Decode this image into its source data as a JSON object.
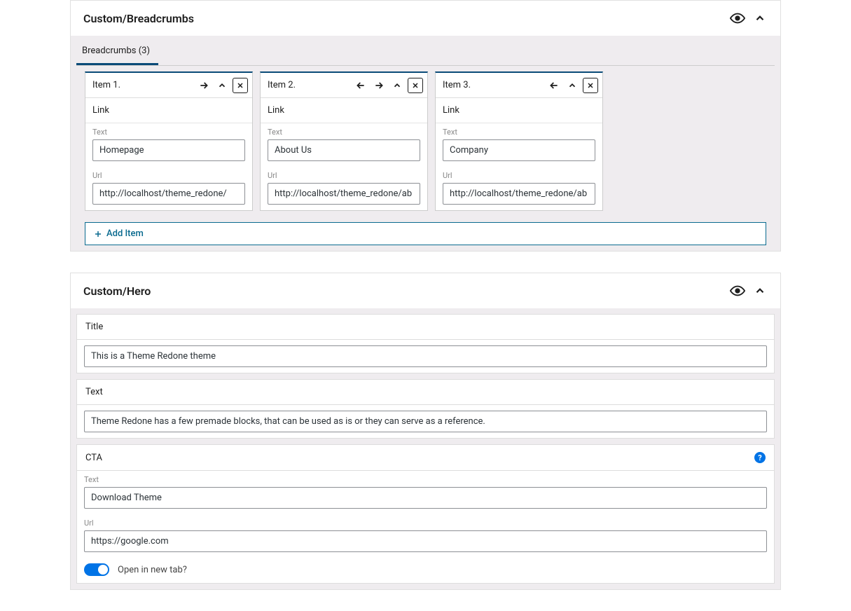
{
  "blocks": {
    "breadcrumbs": {
      "title": "Custom/Breadcrumbs",
      "tab_label": "Breadcrumbs (3)",
      "add_item_label": "Add Item",
      "items": [
        {
          "title": "Item 1.",
          "show_prev": false,
          "show_next": true,
          "link_label": "Link",
          "text_label": "Text",
          "text_value": "Homepage",
          "url_label": "Url",
          "url_value": "http://localhost/theme_redone/"
        },
        {
          "title": "Item 2.",
          "show_prev": true,
          "show_next": true,
          "link_label": "Link",
          "text_label": "Text",
          "text_value": "About Us",
          "url_label": "Url",
          "url_value": "http://localhost/theme_redone/ab"
        },
        {
          "title": "Item 3.",
          "show_prev": true,
          "show_next": false,
          "link_label": "Link",
          "text_label": "Text",
          "text_value": "Company",
          "url_label": "Url",
          "url_value": "http://localhost/theme_redone/ab"
        }
      ]
    },
    "hero": {
      "title": "Custom/Hero",
      "title_field": {
        "label": "Title",
        "value": "This is a Theme Redone theme"
      },
      "text_field": {
        "label": "Text",
        "value": "Theme Redone has a few premade blocks, that can be used as is or they can serve as a reference."
      },
      "cta": {
        "label": "CTA",
        "text_label": "Text",
        "text_value": "Download Theme",
        "url_label": "Url",
        "url_value": "https://google.com",
        "new_tab_label": "Open in new tab?",
        "new_tab_value": true
      }
    }
  }
}
